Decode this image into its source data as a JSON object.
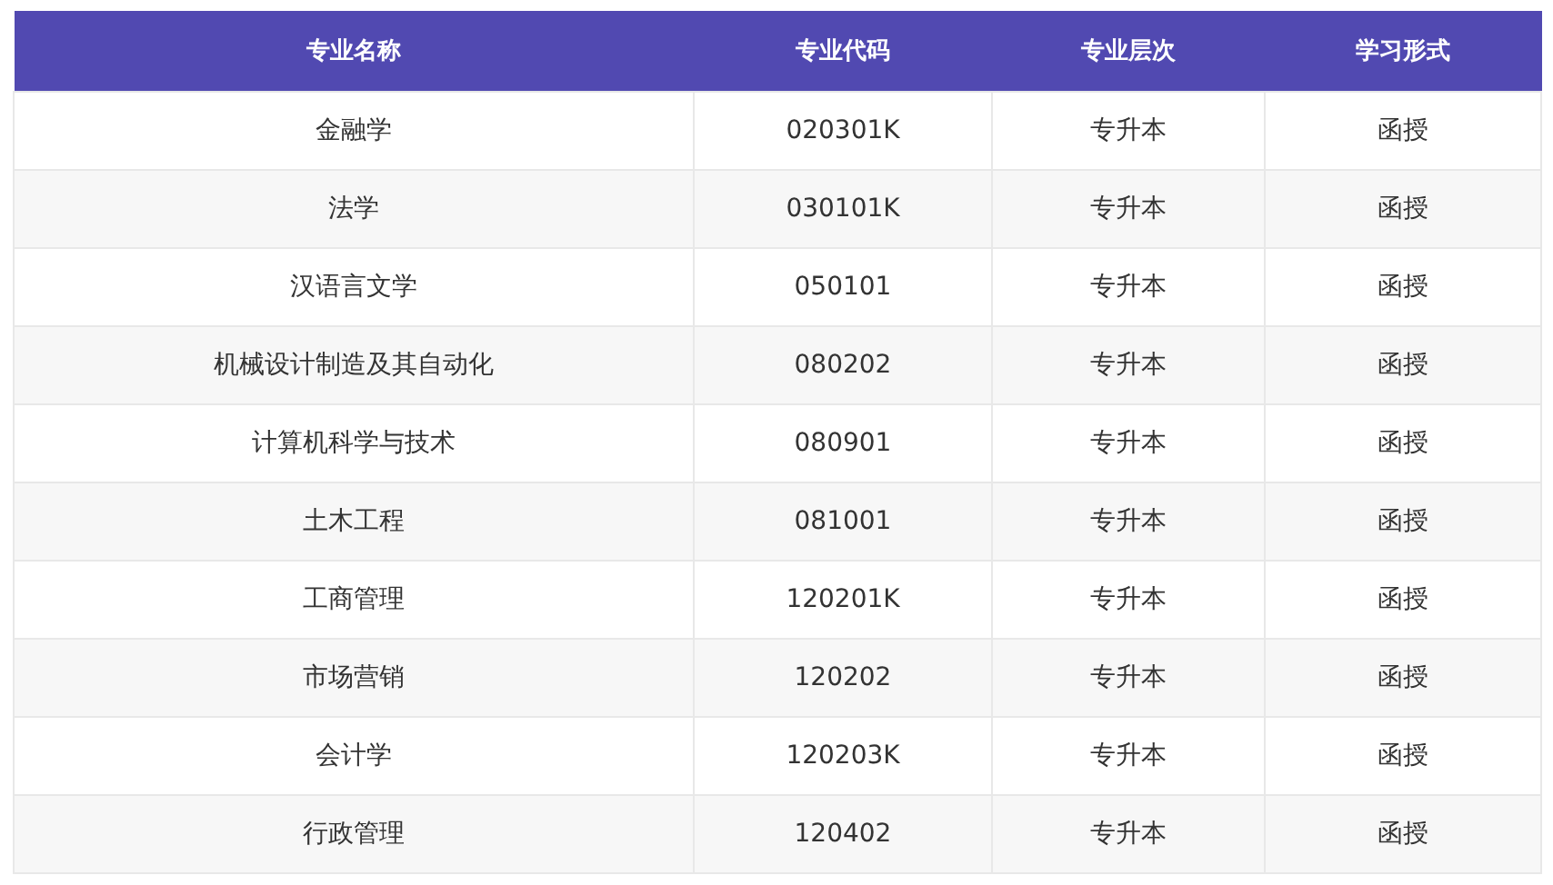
{
  "table": {
    "columns": [
      "专业名称",
      "专业代码",
      "专业层次",
      "学习形式"
    ],
    "rows": [
      [
        "金融学",
        "020301K",
        "专升本",
        "函授"
      ],
      [
        "法学",
        "030101K",
        "专升本",
        "函授"
      ],
      [
        "汉语言文学",
        "050101",
        "专升本",
        "函授"
      ],
      [
        "机械设计制造及其自动化",
        "080202",
        "专升本",
        "函授"
      ],
      [
        "计算机科学与技术",
        "080901",
        "专升本",
        "函授"
      ],
      [
        "土木工程",
        "081001",
        "专升本",
        "函授"
      ],
      [
        "工商管理",
        "120201K",
        "专升本",
        "函授"
      ],
      [
        "市场营销",
        "120202",
        "专升本",
        "函授"
      ],
      [
        "会计学",
        "120203K",
        "专升本",
        "函授"
      ],
      [
        "行政管理",
        "120402",
        "专升本",
        "函授"
      ]
    ]
  }
}
